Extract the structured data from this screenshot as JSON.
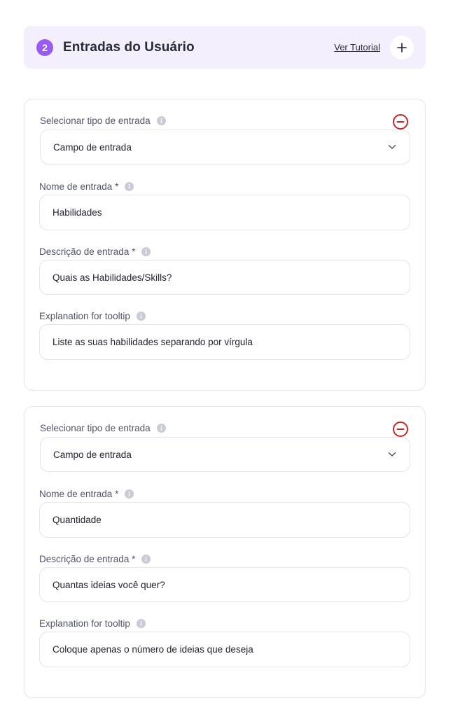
{
  "header": {
    "step_number": "2",
    "title": "Entradas do Usuário",
    "tutorial_link": "Ver Tutorial",
    "add_icon": "plus-icon",
    "accent_color": "#9a5cf0",
    "background_color": "#f4effd"
  },
  "inputs": [
    {
      "type_label": "Selecionar tipo de entrada",
      "type_value": "Campo de entrada",
      "name_label": "Nome de entrada *",
      "name_value": "Habilidades",
      "description_label": "Descrição de entrada *",
      "description_value": "Quais as Habilidades/Skills?",
      "tooltip_label": "Explanation for tooltip",
      "tooltip_value": "Liste as suas habilidades separando por vírgula"
    },
    {
      "type_label": "Selecionar tipo de entrada",
      "type_value": "Campo de entrada",
      "name_label": "Nome de entrada *",
      "name_value": "Quantidade",
      "description_label": "Descrição de entrada *",
      "description_value": "Quantas ideias você quer?",
      "tooltip_label": "Explanation for tooltip",
      "tooltip_value": "Coloque apenas o número de ideias que deseja"
    }
  ],
  "icons": {
    "info": "info-icon",
    "remove": "minus-circle-icon",
    "dropdown": "chevron-down-icon"
  },
  "colors": {
    "remove": "#c62828",
    "info": "#c9cbd6",
    "border": "#e4e4ea"
  }
}
